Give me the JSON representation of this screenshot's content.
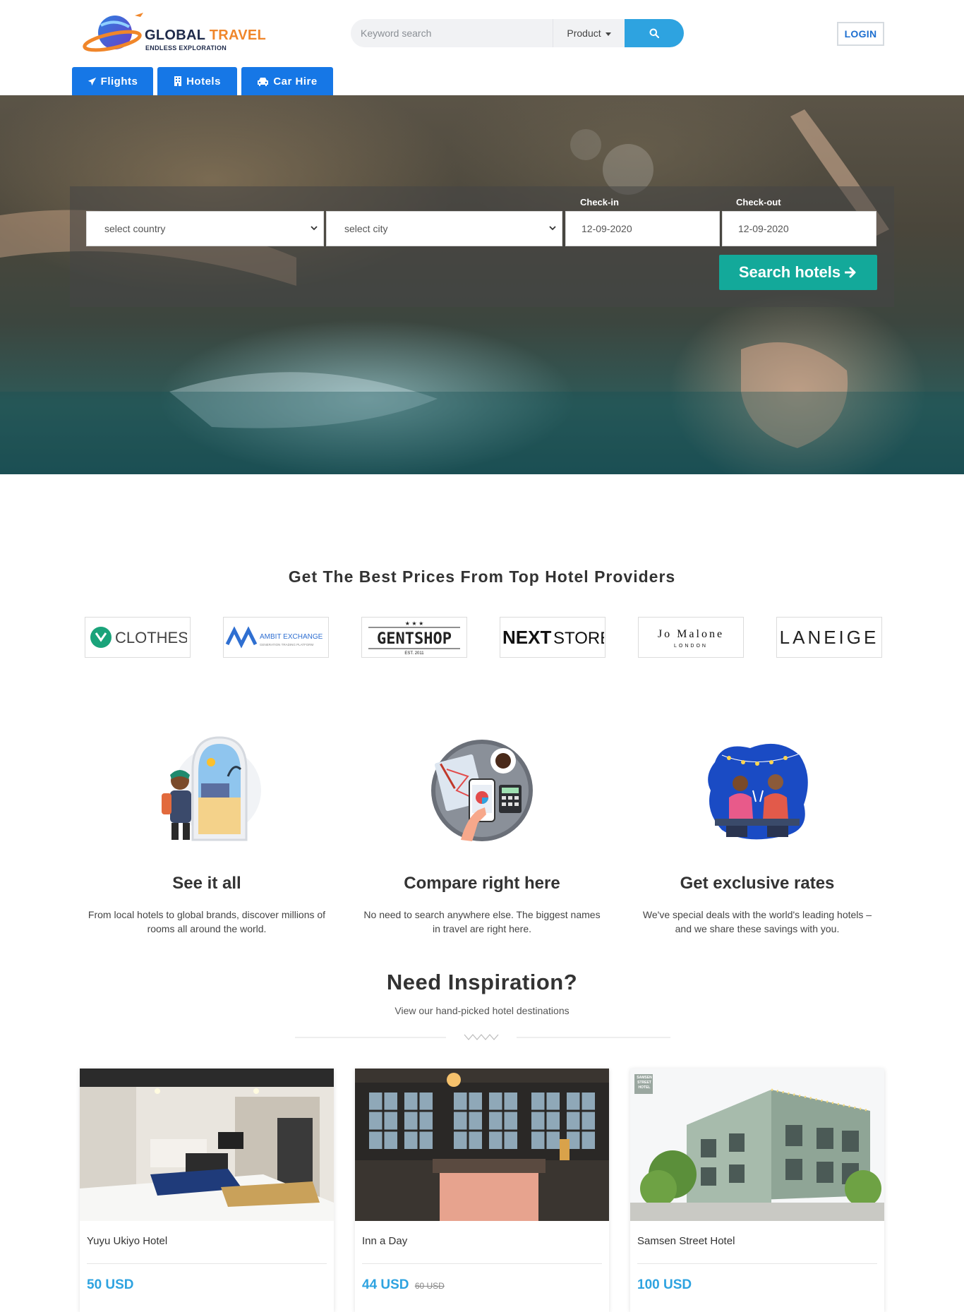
{
  "brand": {
    "name_part1": "GLOBAL",
    "name_part2": "TRAVEL",
    "tagline": "ENDLESS EXPLORATION"
  },
  "search": {
    "placeholder": "Keyword search",
    "product_label": "Product"
  },
  "header": {
    "login_label": "LOGIN"
  },
  "tabs": [
    {
      "label": "Flights",
      "icon": "plane-icon"
    },
    {
      "label": "Hotels",
      "icon": "building-icon"
    },
    {
      "label": "Car Hire",
      "icon": "car-icon"
    }
  ],
  "hero_form": {
    "country_placeholder": "select country",
    "city_placeholder": "select city",
    "checkin_label": "Check-in",
    "checkout_label": "Check-out",
    "checkin_value": "12-09-2020",
    "checkout_value": "12-09-2020",
    "submit_label": "Search hotels"
  },
  "providers": {
    "title": "Get The Best Prices From Top Hotel Providers",
    "logos": [
      "CLOTHES",
      "AMBIT EXCHANGE",
      "GENTSHOP",
      "NEXTSTORE",
      "JO MALONE LONDON",
      "LANEIGE"
    ],
    "logo_details": {
      "ambit_sub": "GENERATION TRADING PLATFORM",
      "gentshop_est": "EST. 2011",
      "jomalone_main": "Jo Malone",
      "jomalone_city": "LONDON",
      "next_part1": "NEXT",
      "next_part2": "STORE"
    }
  },
  "features": [
    {
      "title": "See it all",
      "text": "From local hotels to global brands, discover millions of rooms all around the world."
    },
    {
      "title": "Compare right here",
      "text": "No need to search anywhere else. The biggest names in travel are right here."
    },
    {
      "title": "Get exclusive rates",
      "text": "We've special deals with the world's leading hotels – and we share these savings with you."
    }
  ],
  "inspiration": {
    "title": "Need Inspiration?",
    "subtitle": "View our hand-picked hotel destinations"
  },
  "hotels": [
    {
      "name": "Yuyu Ukiyo Hotel",
      "price": "50 USD",
      "old_price": ""
    },
    {
      "name": "Inn a Day",
      "price": "44 USD",
      "old_price": "60 USD"
    },
    {
      "name": "Samsen Street Hotel",
      "price": "100 USD",
      "old_price": "",
      "sign_text": "SAMSEN STREET HOTEL"
    }
  ],
  "colors": {
    "tab_blue": "#1677e6",
    "search_btn": "#2ea3e0",
    "submit_green": "#13a99a",
    "price_blue": "#2ea3e0",
    "logo_orange": "#f0862a"
  }
}
